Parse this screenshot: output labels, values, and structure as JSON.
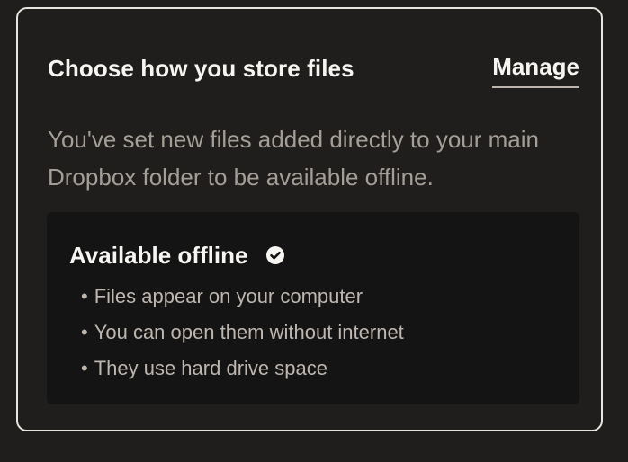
{
  "card": {
    "title": "Choose how you store files",
    "manage_label": "Manage",
    "description": "You've set new files added directly to your main Dropbox folder to be available offline."
  },
  "offline": {
    "title": "Available offline",
    "icon": "check-circle-icon",
    "bullets": [
      "Files appear on your computer",
      "You can open them without internet",
      "They use hard drive space"
    ]
  }
}
